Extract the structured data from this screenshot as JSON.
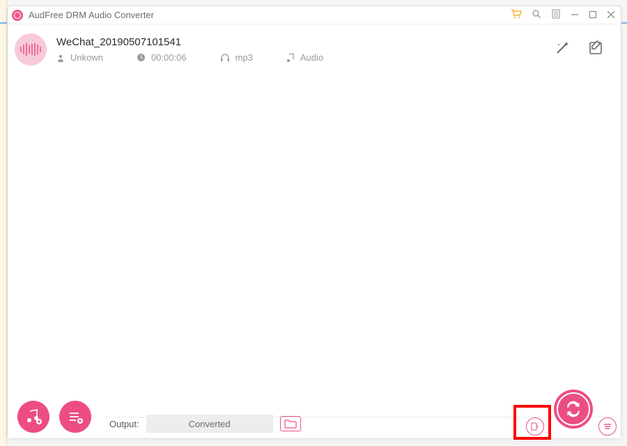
{
  "app": {
    "title": "AudFree DRM Audio Converter"
  },
  "file": {
    "title": "WeChat_20190507101541",
    "artist": "Unkown",
    "duration": "00:00:06",
    "format": "mp3",
    "type": "Audio"
  },
  "output": {
    "label": "Output:",
    "status": "Converted"
  },
  "colors": {
    "accent": "#ec4d84",
    "accent_light": "#f7cadb",
    "highlight": "#ff0000"
  }
}
